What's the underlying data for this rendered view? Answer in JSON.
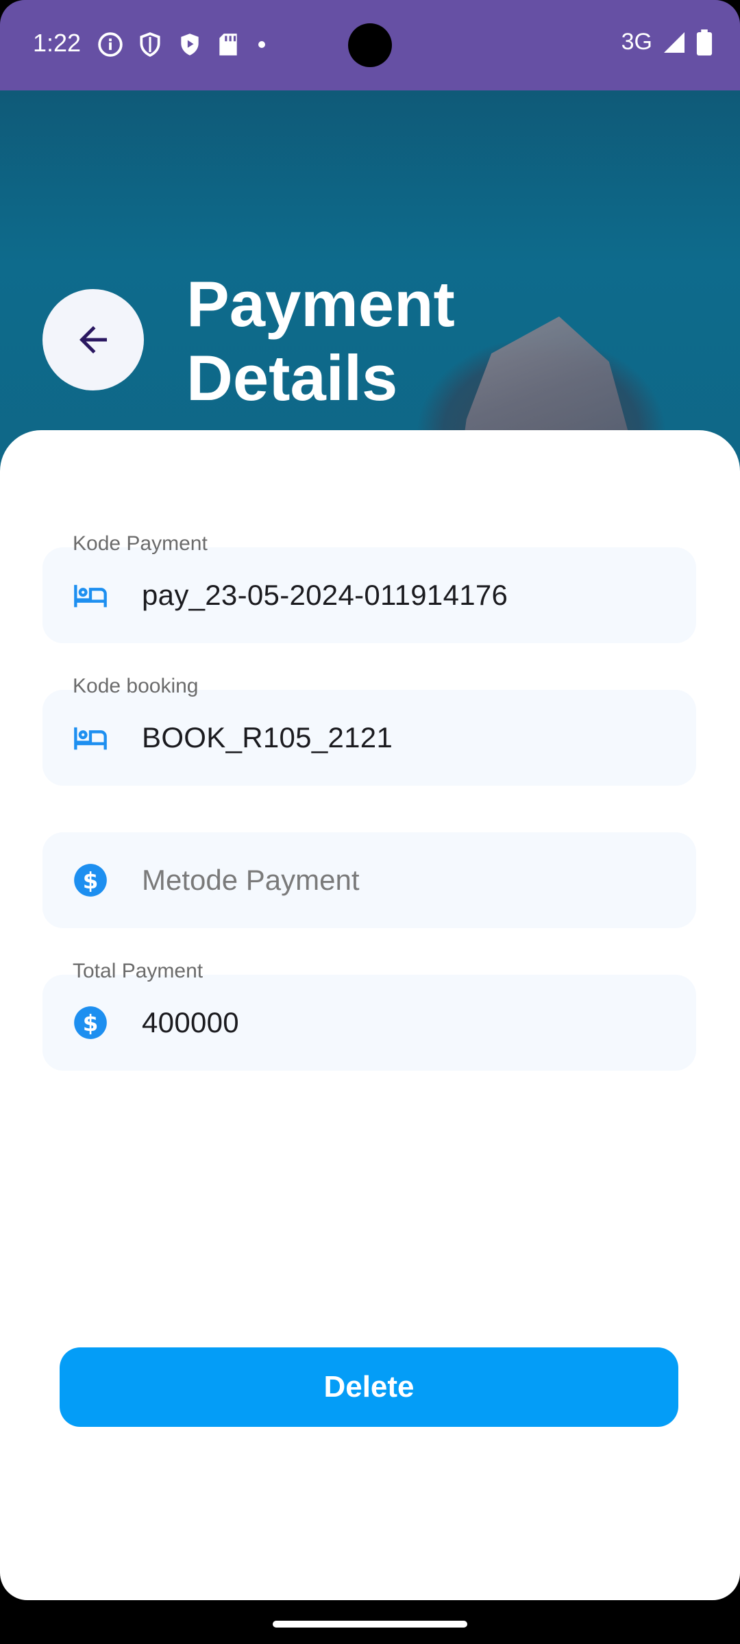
{
  "status_bar": {
    "time": "1:22",
    "network": "3G",
    "icons": [
      "info-icon",
      "shield-icon",
      "play-shield-icon",
      "sd-card-icon",
      "dot-icon",
      "signal-icon",
      "battery-icon"
    ]
  },
  "header": {
    "title": "Payment Details",
    "back_icon": "arrow-back-icon"
  },
  "fields": {
    "kode_payment": {
      "label": "Kode Payment",
      "value": "pay_23-05-2024-011914176",
      "icon": "bed-icon"
    },
    "kode_booking": {
      "label": "Kode booking",
      "value": "BOOK_R105_2121",
      "icon": "bed-icon"
    },
    "metode_payment": {
      "placeholder": "Metode Payment",
      "icon": "dollar-circle-icon"
    },
    "total_payment": {
      "label": "Total Payment",
      "value": "400000",
      "icon": "dollar-circle-icon"
    }
  },
  "actions": {
    "delete_label": "Delete"
  },
  "colors": {
    "status_bar": "#6650a4",
    "accent": "#049df7",
    "field_bg": "#f5f9fe"
  }
}
